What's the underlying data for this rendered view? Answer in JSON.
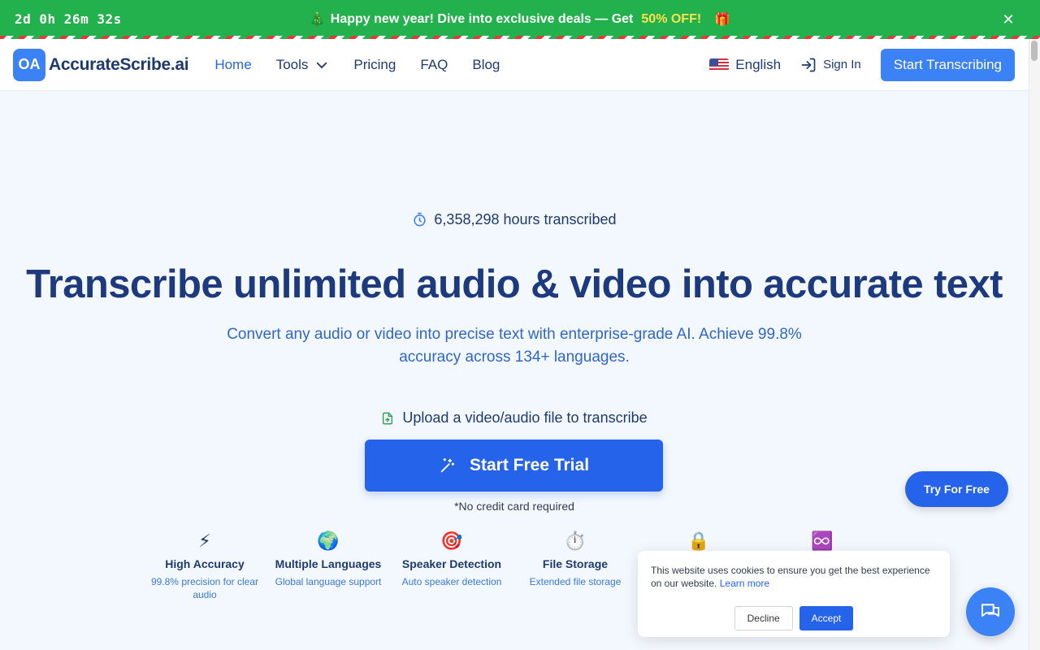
{
  "promo": {
    "countdown": "2d 0h 26m 32s",
    "emoji": "🎄",
    "text": "Happy new year! Dive into exclusive deals — Get",
    "highlight": "50% OFF!",
    "gift_icon": "🎁",
    "close_icon": "✕"
  },
  "nav": {
    "logo_mark": "OA",
    "logo_text": "AccurateScribe.ai",
    "links": [
      "Home",
      "Tools",
      "Pricing",
      "FAQ",
      "Blog"
    ],
    "language": "English",
    "signin": "Sign In",
    "cta": "Start Transcribing"
  },
  "hero": {
    "hours": "6,358,298 hours transcribed",
    "headline": "Transcribe unlimited audio & video into accurate text",
    "subline": "Convert any audio or video into precise text with enterprise-grade AI. Achieve 99.8% accuracy across 134+ languages.",
    "upload_label": "Upload a video/audio file to transcribe",
    "trial_button": "Start Free Trial",
    "no_credit_card": "*No credit card required"
  },
  "features": [
    {
      "icon": "⚡",
      "title": "High Accuracy",
      "sub": "99.8% precision for clear audio"
    },
    {
      "icon": "🌍",
      "title": "Multiple Languages",
      "sub": "Global language support"
    },
    {
      "icon": "🎯",
      "title": "Speaker Detection",
      "sub": "Auto speaker detection"
    },
    {
      "icon": "⏱️",
      "title": "File Storage",
      "sub": "Extended file storage"
    },
    {
      "icon": "🔒",
      "title": "",
      "sub": ""
    },
    {
      "icon": "♾️",
      "title": "",
      "sub": ""
    }
  ],
  "floating": {
    "try_free": "Try For Free"
  },
  "cookie": {
    "text": "This website uses cookies to ensure you get the best experience on our website.",
    "learn_more": "Learn more",
    "decline": "Decline",
    "accept": "Accept"
  },
  "colors": {
    "primary": "#2563eb",
    "promo_bg": "#23b14d",
    "highlight": "#ffe14d",
    "heading": "#1e3a7e"
  }
}
